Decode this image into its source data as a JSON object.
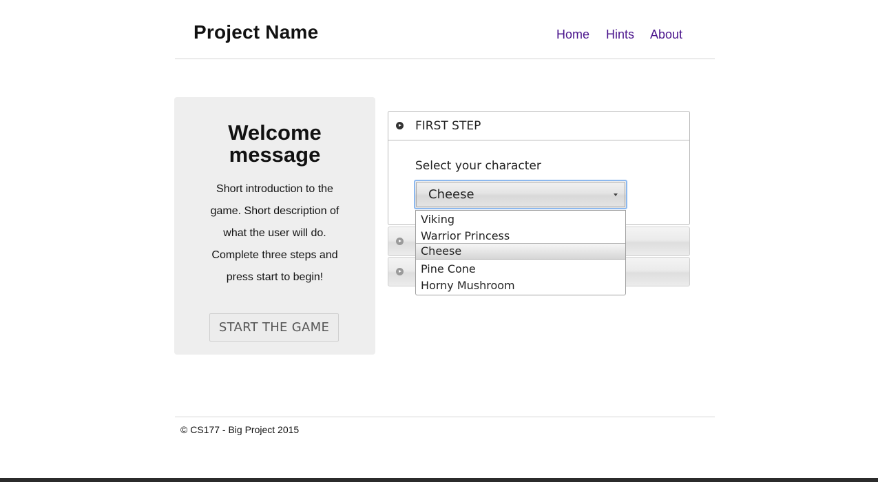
{
  "header": {
    "brand": "Project Name",
    "nav": [
      "Home",
      "Hints",
      "About"
    ]
  },
  "welcome": {
    "title_line1": "Welcome",
    "title_line2": "message",
    "intro_lines": [
      "Short introduction to the",
      "game. Short description of",
      "what the user will do.",
      "Complete three steps and",
      "press start to begin!"
    ],
    "start_button": "START THE GAME"
  },
  "steps": {
    "first_title": "FIRST STEP",
    "select_label": "Select your character",
    "select_value": "Cheese",
    "options": [
      "Viking",
      "Warrior Princess",
      "Cheese",
      "Pine Cone",
      "Horny Mushroom"
    ],
    "selected_option": "Cheese"
  },
  "footer": {
    "text": "© CS177 - Big Project 2015"
  },
  "colors": {
    "nav_link": "#4a148c",
    "panel_bg": "#eeeeee",
    "focus_ring": "#8cb8ee"
  }
}
